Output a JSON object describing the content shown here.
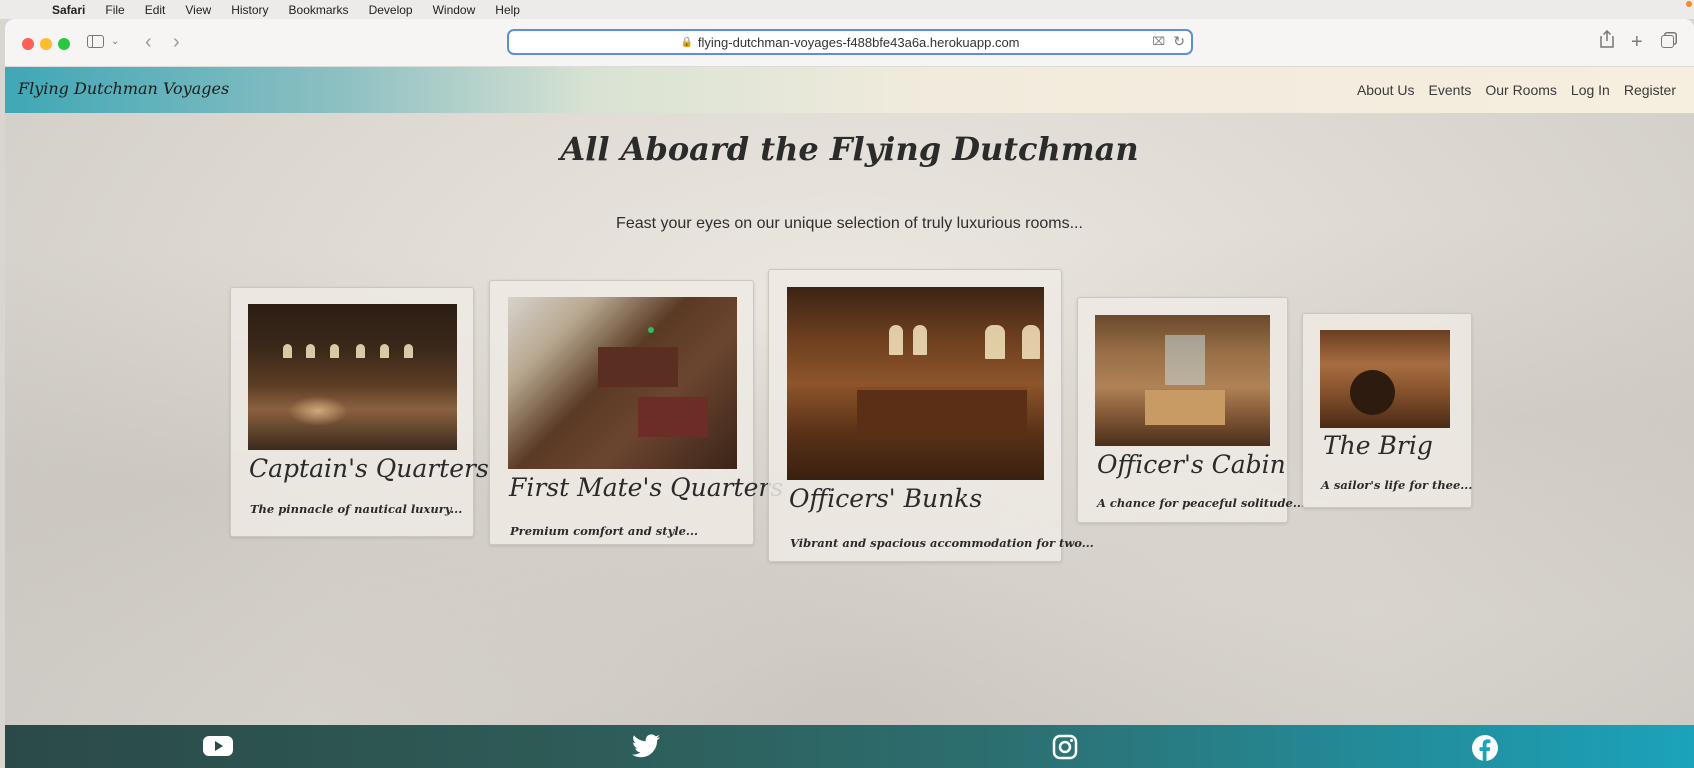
{
  "menubar": {
    "items": [
      "Safari",
      "File",
      "Edit",
      "View",
      "History",
      "Bookmarks",
      "Develop",
      "Window",
      "Help"
    ]
  },
  "browser": {
    "url": "flying-dutchman-voyages-f488bfe43a6a.herokuapp.com"
  },
  "site": {
    "brand": "Flying Dutchman Voyages",
    "nav": [
      "About Us",
      "Events",
      "Our Rooms",
      "Log In",
      "Register"
    ],
    "title": "All Aboard the Flying Dutchman",
    "subtitle": "Feast your eyes on our unique selection of truly luxurious rooms...",
    "rooms": [
      {
        "name": "Captain's Quarters",
        "blurb": "The pinnacle of nautical luxury..."
      },
      {
        "name": "First Mate's Quarters",
        "blurb": "Premium comfort and style..."
      },
      {
        "name": "Officers' Bunks",
        "blurb": "Vibrant and spacious accommodation for two..."
      },
      {
        "name": "Officer's Cabin",
        "blurb": "A chance for peaceful solitude..."
      },
      {
        "name": "The Brig",
        "blurb": "A sailor's life for thee..."
      }
    ],
    "footer_icons": [
      "youtube-icon",
      "twitter-icon",
      "instagram-icon",
      "facebook-icon"
    ]
  }
}
